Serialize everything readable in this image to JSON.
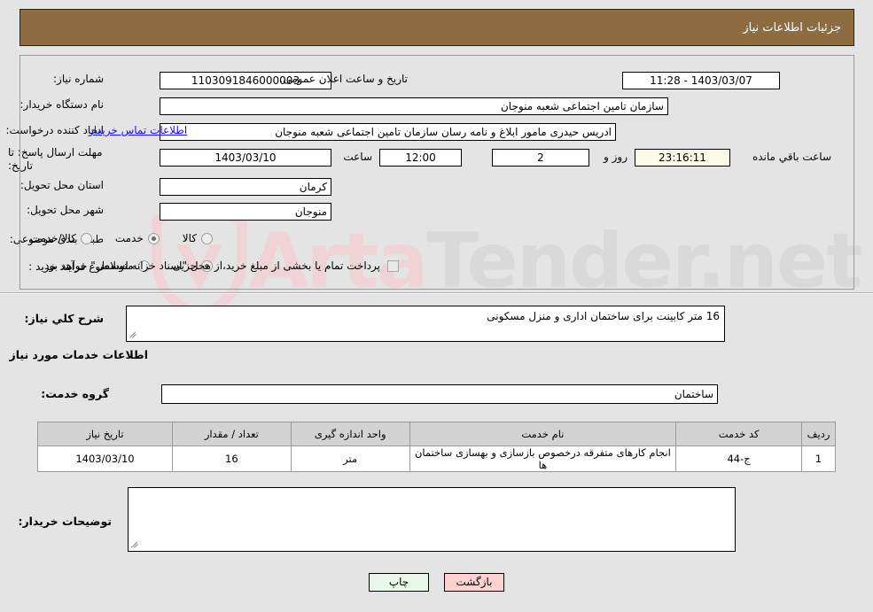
{
  "header": {
    "title": "جزئیات اطلاعات نیاز"
  },
  "watermark": {
    "text_a": "Arta",
    "text_b": "Tender",
    "suffix": ".net"
  },
  "summary": {
    "need_number": {
      "label": "شماره نیاز:",
      "value": "1103091846000003"
    },
    "public_announce": {
      "label": "تاریخ و ساعت اعلان عمومی:",
      "value": "1403/03/07 - 11:28"
    },
    "buyer_org": {
      "label": "نام دستگاه خریدار:",
      "value": "سازمان تامین اجتماعی شعبه منوجان"
    },
    "request_creator": {
      "label": "ایجاد کننده درخواست:",
      "value": "ادریس  حیدری مامور ابلاغ و نامه رسان سازمان تامین اجتماعی شعبه منوجان",
      "contact_link": "اطلاعات تماس خریدار"
    },
    "deadline": {
      "label": "مهلت ارسال پاسخ: تا تاریخ:",
      "date": "1403/03/10",
      "time_label": "ساعت",
      "time": "12:00",
      "days_remaining": "2",
      "days_unit": "روز و",
      "time_remaining": "23:16:11",
      "remaining_suffix": "ساعت باقي مانده"
    },
    "province": {
      "label": "استان محل تحویل:",
      "value": "کرمان"
    },
    "city": {
      "label": "شهر محل تحویل:",
      "value": "منوجان"
    },
    "subject_class": {
      "label": "طبقه بندی موضوعی:",
      "options": [
        {
          "label": "کالا",
          "selected": false
        },
        {
          "label": "خدمت",
          "selected": true
        },
        {
          "label": "کالا/خدمت",
          "selected": false
        }
      ]
    },
    "purchase_type": {
      "label": "نوع فرآیند خرید :",
      "options": [
        {
          "label": "جزیی",
          "selected": true
        },
        {
          "label": "متوسط",
          "selected": false
        }
      ],
      "treasury_checkbox": {
        "checked": false,
        "note": "پرداخت تمام یا بخشی از مبلغ خرید،از محل \"اسناد خزانه اسلامی\" خواهد بود."
      }
    }
  },
  "description": {
    "label": "شرح کلي نیاز:",
    "value": "16 متر کابینت برای ساختمان اداری و منزل مسکونی"
  },
  "services_section": {
    "heading": "اطلاعات خدمات مورد نیاز",
    "service_group": {
      "label": "گروه خدمت:",
      "value": "ساختمان"
    },
    "table": {
      "columns": [
        "ردیف",
        "کد خدمت",
        "نام خدمت",
        "واحد اندازه گیری",
        "تعداد / مقدار",
        "تاریخ نیاز"
      ],
      "rows": [
        {
          "row_no": "1",
          "service_code": "ج-44",
          "service_name": "انجام کارهای متفرقه درخصوص بازسازی و بهسازی ساختمان ها",
          "unit": "متر",
          "quantity": "16",
          "need_date": "1403/03/10"
        }
      ]
    }
  },
  "buyer_notes": {
    "label": "توضیحات خریدار:",
    "value": ""
  },
  "footer": {
    "back_button": "بازگشت",
    "print_button": "چاپ"
  },
  "colors": {
    "header_bg": "#8d6c42",
    "page_bg": "#e4e4e4",
    "link": "#1b12ee",
    "back_btn": "#ffd0d0",
    "print_btn": "#e9f7e9"
  }
}
